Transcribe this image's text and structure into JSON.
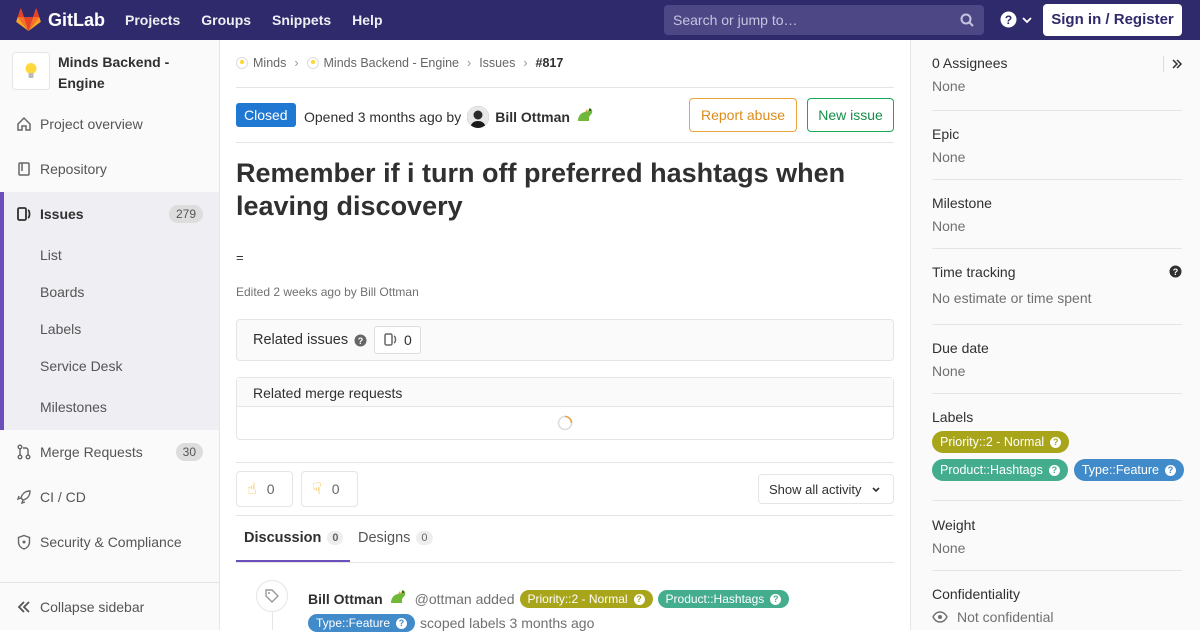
{
  "topbar": {
    "brand": "GitLab",
    "nav": [
      "Projects",
      "Groups",
      "Snippets",
      "Help"
    ],
    "search_placeholder": "Search or jump to…",
    "signin": "Sign in / Register"
  },
  "sidebar": {
    "project_name": "Minds Backend - Engine",
    "items": [
      {
        "label": "Project overview",
        "icon": "home-icon"
      },
      {
        "label": "Repository",
        "icon": "repository-icon"
      },
      {
        "label": "Issues",
        "count": "279",
        "icon": "issues-icon"
      },
      {
        "label": "Merge Requests",
        "count": "30",
        "icon": "merge-request-icon"
      },
      {
        "label": "CI / CD",
        "icon": "rocket-icon"
      },
      {
        "label": "Security & Compliance",
        "icon": "shield-icon"
      }
    ],
    "sub_items": [
      "List",
      "Boards",
      "Labels",
      "Service Desk",
      "Milestones"
    ],
    "collapse": "Collapse sidebar"
  },
  "breadcrumb": [
    "Minds",
    "Minds Backend - Engine",
    "Issues",
    "#817"
  ],
  "issue": {
    "status": "Closed",
    "opened_text": "Opened 3 months ago by",
    "author": "Bill Ottman",
    "title": "Remember if i turn off preferred hashtags when leaving discovery",
    "description": "=",
    "edited": "Edited 2 weeks ago by Bill Ottman",
    "report_abuse": "Report abuse",
    "new_issue": "New issue"
  },
  "related_issues": {
    "label": "Related issues",
    "count": "0"
  },
  "related_mrs": {
    "label": "Related merge requests"
  },
  "reactions": {
    "thumbs_up": "0",
    "thumbs_down": "0"
  },
  "show_activity": "Show all activity",
  "tabs": [
    {
      "label": "Discussion",
      "count": "0"
    },
    {
      "label": "Designs",
      "count": "0"
    }
  ],
  "activity": {
    "author": "Bill Ottman",
    "handle": "@ottman added",
    "suffix": "scoped labels 3 months ago"
  },
  "labels": [
    {
      "text": "Priority::2 - Normal",
      "color": "#a8a51a"
    },
    {
      "text": "Product::Hashtags",
      "color": "#44ad8e"
    },
    {
      "text": "Type::Feature",
      "color": "#428bca"
    }
  ],
  "right": {
    "assignees": "0 Assignees",
    "assignees_value": "None",
    "epic": "Epic",
    "epic_value": "None",
    "milestone": "Milestone",
    "milestone_value": "None",
    "time_tracking": "Time tracking",
    "time_value": "No estimate or time spent",
    "due_date": "Due date",
    "due_value": "None",
    "labels": "Labels",
    "weight": "Weight",
    "weight_value": "None",
    "confidentiality": "Confidentiality",
    "confidentiality_value": "Not confidential"
  }
}
